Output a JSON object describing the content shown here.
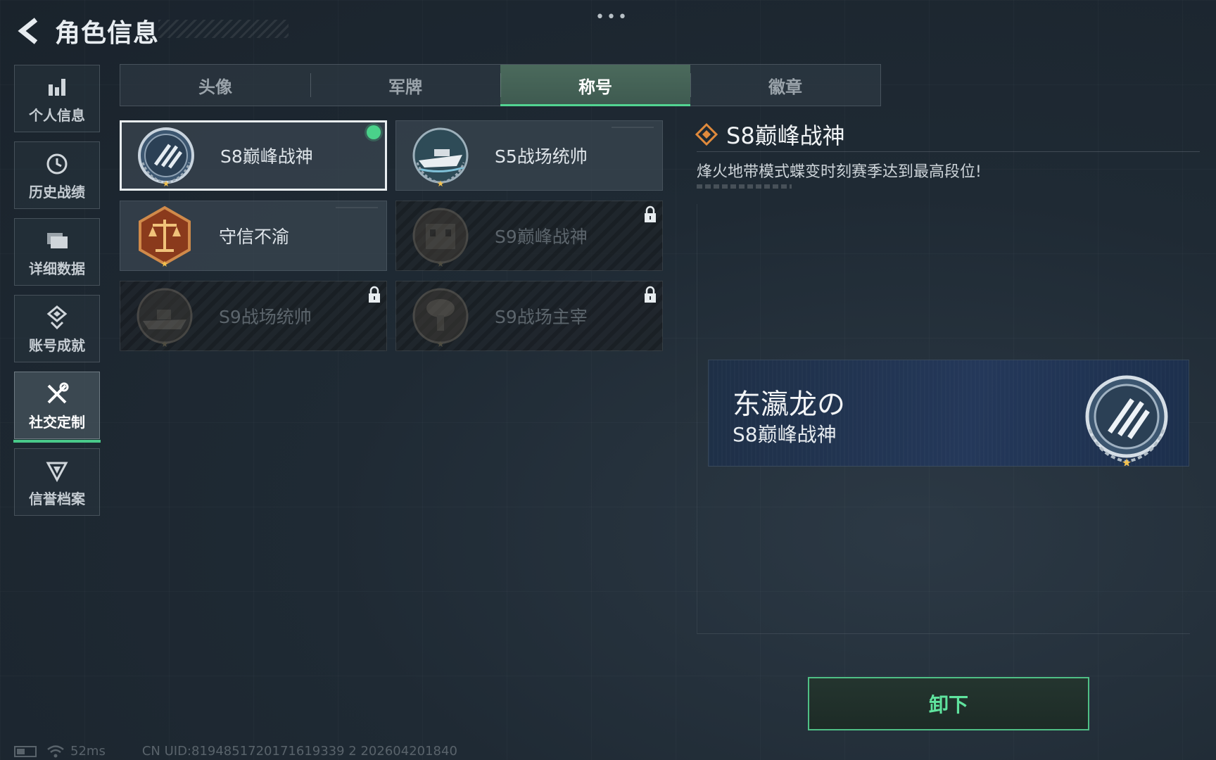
{
  "header": {
    "title": "角色信息"
  },
  "sidebar": {
    "items": [
      {
        "label": "个人信息",
        "icon": "bar-chart-icon",
        "active": false
      },
      {
        "label": "历史战绩",
        "icon": "history-icon",
        "active": false
      },
      {
        "label": "详细数据",
        "icon": "folder-icon",
        "active": false
      },
      {
        "label": "账号成就",
        "icon": "achievement-icon",
        "active": false
      },
      {
        "label": "社交定制",
        "icon": "tools-icon",
        "active": true
      },
      {
        "label": "信誉档案",
        "icon": "credit-icon",
        "active": false
      }
    ]
  },
  "tabs": [
    {
      "label": "头像",
      "active": false
    },
    {
      "label": "军牌",
      "active": false
    },
    {
      "label": "称号",
      "active": true
    },
    {
      "label": "徽章",
      "active": false
    }
  ],
  "titles": [
    {
      "name": "S8巅峰战神",
      "status": "equipped",
      "icon": "s8-peak-emblem-icon"
    },
    {
      "name": "S5战场统帅",
      "status": "owned",
      "icon": "speedboat-emblem-icon"
    },
    {
      "name": "守信不渝",
      "status": "owned",
      "icon": "scales-emblem-icon"
    },
    {
      "name": "S9巅峰战神",
      "status": "locked",
      "icon": "building-emblem-icon"
    },
    {
      "name": "S9战场统帅",
      "status": "locked",
      "icon": "warship-emblem-icon"
    },
    {
      "name": "S9战场主宰",
      "status": "locked",
      "icon": "mushroom-cloud-emblem-icon"
    }
  ],
  "detail": {
    "name": "S8巅峰战神",
    "description": "烽火地带模式蝶变时刻赛季达到最高段位!"
  },
  "namecard": {
    "player_name": "东瀛龙の",
    "title": "S8巅峰战神"
  },
  "action": {
    "label": "卸下"
  },
  "status": {
    "ping": "52ms",
    "uid": "CN UID:8194851720171619339 2 202604201840"
  },
  "colors": {
    "accent": "#4ad28a",
    "detail_icon": "#e08a3c"
  }
}
